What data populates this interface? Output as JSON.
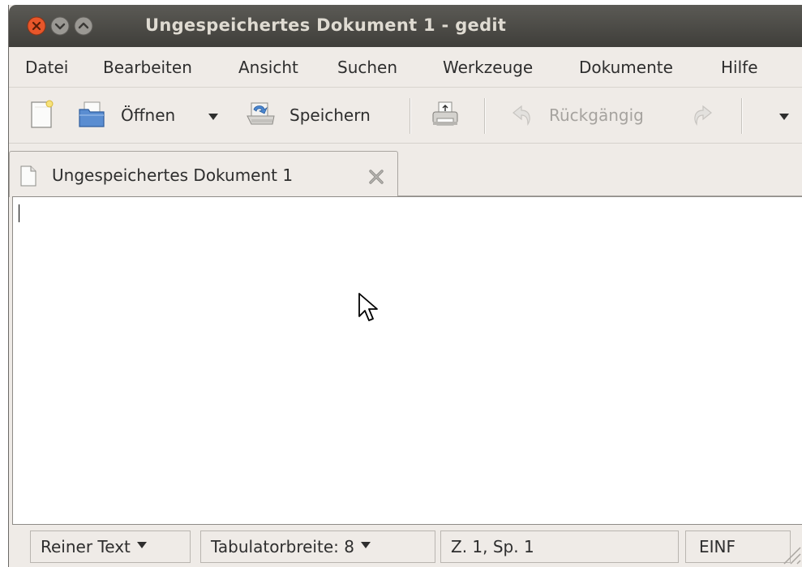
{
  "window": {
    "title": "Ungespeichertes Dokument 1 - gedit",
    "controls": [
      "close-icon",
      "minimize-icon",
      "maximize-icon"
    ]
  },
  "menubar": {
    "items": [
      {
        "label": "Datei"
      },
      {
        "label": "Bearbeiten"
      },
      {
        "label": "Ansicht"
      },
      {
        "label": "Suchen"
      },
      {
        "label": "Werkzeuge"
      },
      {
        "label": "Dokumente"
      },
      {
        "label": "Hilfe"
      }
    ]
  },
  "toolbar": {
    "new_icon": "new-document-icon",
    "open_label": "Öffnen",
    "open_icon": "open-folder-icon",
    "save_label": "Speichern",
    "save_icon": "save-icon",
    "print_icon": "print-icon",
    "undo_label": "Rückgängig",
    "undo_icon": "undo-icon",
    "redo_icon": "redo-icon",
    "overflow_icon": "chevron-down-icon"
  },
  "tabs": [
    {
      "label": "Ungespeichertes Dokument 1",
      "icon": "document-icon",
      "close_icon": "close-icon"
    }
  ],
  "editor": {
    "content": ""
  },
  "statusbar": {
    "language": "Reiner Text",
    "tab_width": "Tabulatorbreite: 8",
    "position": "Z. 1, Sp. 1",
    "mode": "EINF"
  },
  "colors": {
    "titlebar": "#4b4a45",
    "chrome": "#efebe7",
    "close_button": "#e8562a"
  }
}
